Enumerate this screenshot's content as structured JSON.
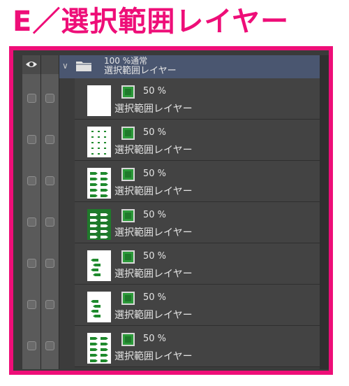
{
  "title": "E／選択範囲レイヤー",
  "colors": {
    "accent": "#ee0e78",
    "mask_green": "#2c9a3a"
  },
  "header": {
    "visibility_icon": "eye-icon",
    "lock_icon": "pen-icon"
  },
  "folder": {
    "opacity_blend": "100 %通常",
    "name": "選択範囲レイヤー"
  },
  "layers": [
    {
      "opacity": "50 %",
      "name": "選択範囲レイヤー",
      "thumbnail": "blank"
    },
    {
      "opacity": "50 %",
      "name": "選択範囲レイヤー",
      "thumbnail": "sparse"
    },
    {
      "opacity": "50 %",
      "name": "選択範囲レイヤー",
      "thumbnail": "arrows"
    },
    {
      "opacity": "50 %",
      "name": "選択範囲レイヤー",
      "thumbnail": "filled"
    },
    {
      "opacity": "50 %",
      "name": "選択範囲レイヤー",
      "thumbnail": "arrows-left"
    },
    {
      "opacity": "50 %",
      "name": "選択範囲レイヤー",
      "thumbnail": "arrows-left"
    },
    {
      "opacity": "50 %",
      "name": "選択範囲レイヤー",
      "thumbnail": "arrows"
    }
  ]
}
